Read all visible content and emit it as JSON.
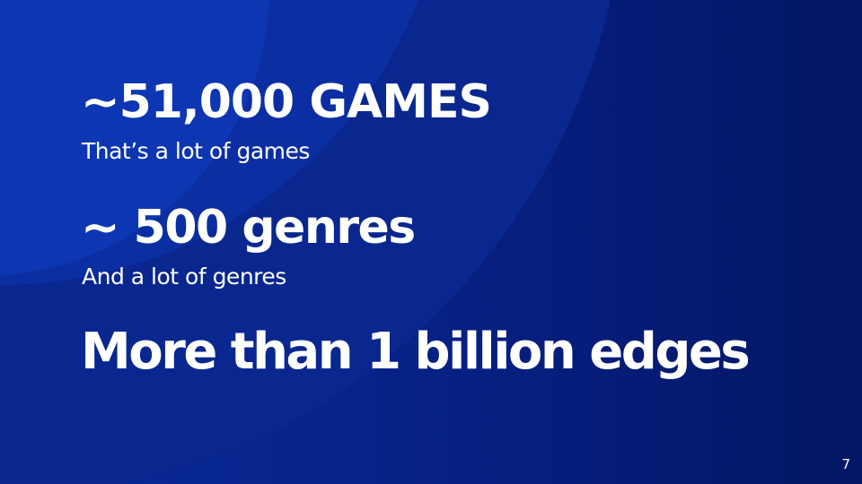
{
  "slide": {
    "stats": [
      {
        "headline": "~51,000 GAMES",
        "subtitle": "That’s a lot of games"
      },
      {
        "headline": "~ 500 genres",
        "subtitle": "And a lot of genres"
      },
      {
        "headline": "More than 1 billion edges"
      }
    ],
    "page_number": "7"
  },
  "colors": {
    "background_dark": "#041763",
    "background_mid": "#072287",
    "arc_light": "#0d36b3",
    "text": "#ffffff"
  }
}
